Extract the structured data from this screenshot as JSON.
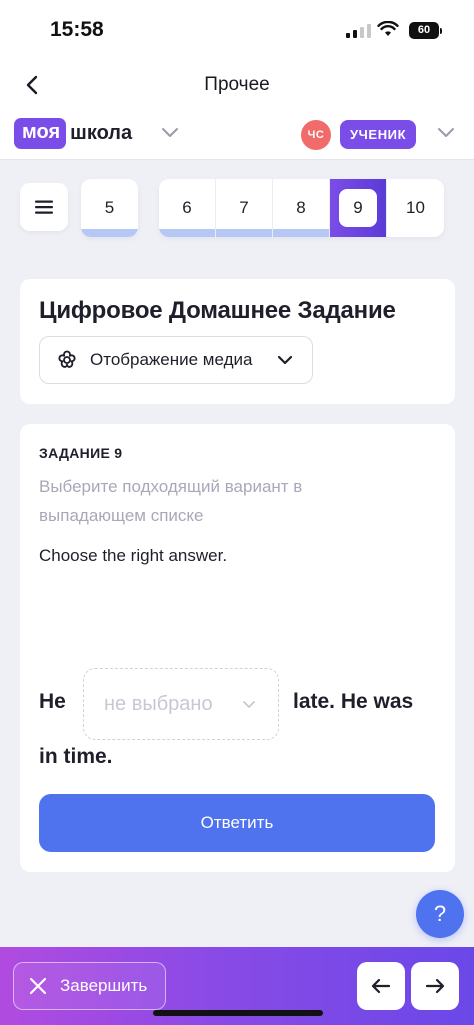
{
  "status_bar": {
    "time": "15:58",
    "battery": "60"
  },
  "nav": {
    "title": "Прочее",
    "back_icon": "chevron-left-icon"
  },
  "school": {
    "logo_part1": "моя",
    "logo_part2": "школа",
    "avatar_initials": "ЧС",
    "role": "УЧЕНИК"
  },
  "question_nav": {
    "items": [
      {
        "label": "5",
        "done": true
      },
      {
        "label": "6",
        "done": true
      },
      {
        "label": "7",
        "done": true
      },
      {
        "label": "8",
        "done": true
      },
      {
        "label": "9",
        "active": true
      },
      {
        "label": "10",
        "done": false
      }
    ]
  },
  "header": {
    "title": "Цифровое Домашнее Задание",
    "media_button": "Отображение медиа"
  },
  "task": {
    "label": "ЗАДАНИЕ 9",
    "hint": "Выберите подходящий вариант в выпадающем списке",
    "instruction": "Choose the right answer.",
    "sentence_start": "He",
    "dropdown_value": "не выбрано",
    "sentence_mid": "late. He was",
    "sentence_end": "in time.",
    "answer_button": "Ответить"
  },
  "help": {
    "label": "?"
  },
  "bottom_bar": {
    "finish_label": "Завершить"
  },
  "colors": {
    "brand_purple": "#7b4de8",
    "accent_blue": "#4f72ee",
    "avatar_red": "#f26b6b",
    "done_bar": "#b4c7f5"
  }
}
